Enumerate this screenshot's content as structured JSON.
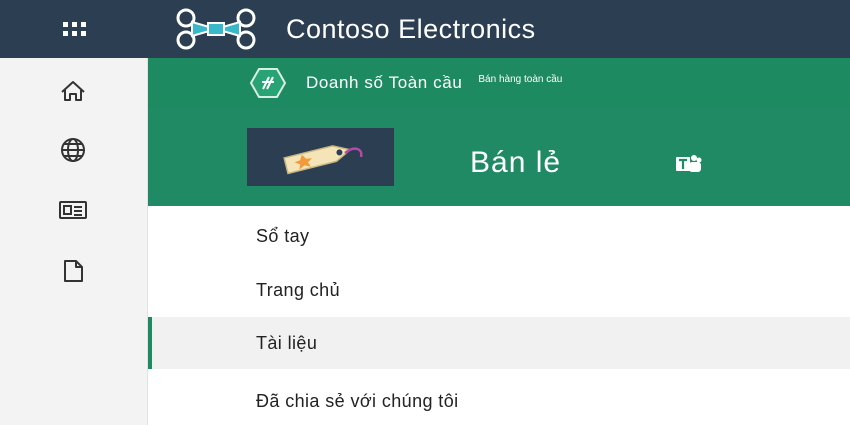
{
  "header": {
    "app_title": "Contoso Electronics",
    "waffle_icon": "app-launcher-icon",
    "logo_icon": "drone-logo-icon",
    "bg_color": "#2b3e52",
    "logo_color": "#38b8c8"
  },
  "rail": {
    "items": [
      {
        "icon": "home-icon"
      },
      {
        "icon": "globe-icon"
      },
      {
        "icon": "news-icon"
      },
      {
        "icon": "file-icon"
      }
    ]
  },
  "hub": {
    "title": "Doanh số Toàn cầu",
    "subtitle": "Bán hàng toàn cầu",
    "logo_icon": "hub-hexagon-logo-icon",
    "bg_color": "#1e8a62"
  },
  "site": {
    "title": "Bán lẻ",
    "logo_icon": "price-tag-icon",
    "teams_icon": "teams-icon"
  },
  "nav": {
    "items": [
      {
        "label": "Sổ tay",
        "selected": false
      },
      {
        "label": "Trang chủ",
        "selected": false
      },
      {
        "label": "Tài liệu",
        "selected": true
      },
      {
        "label": "Đã chia sẻ với chúng tôi",
        "selected": false
      }
    ]
  }
}
